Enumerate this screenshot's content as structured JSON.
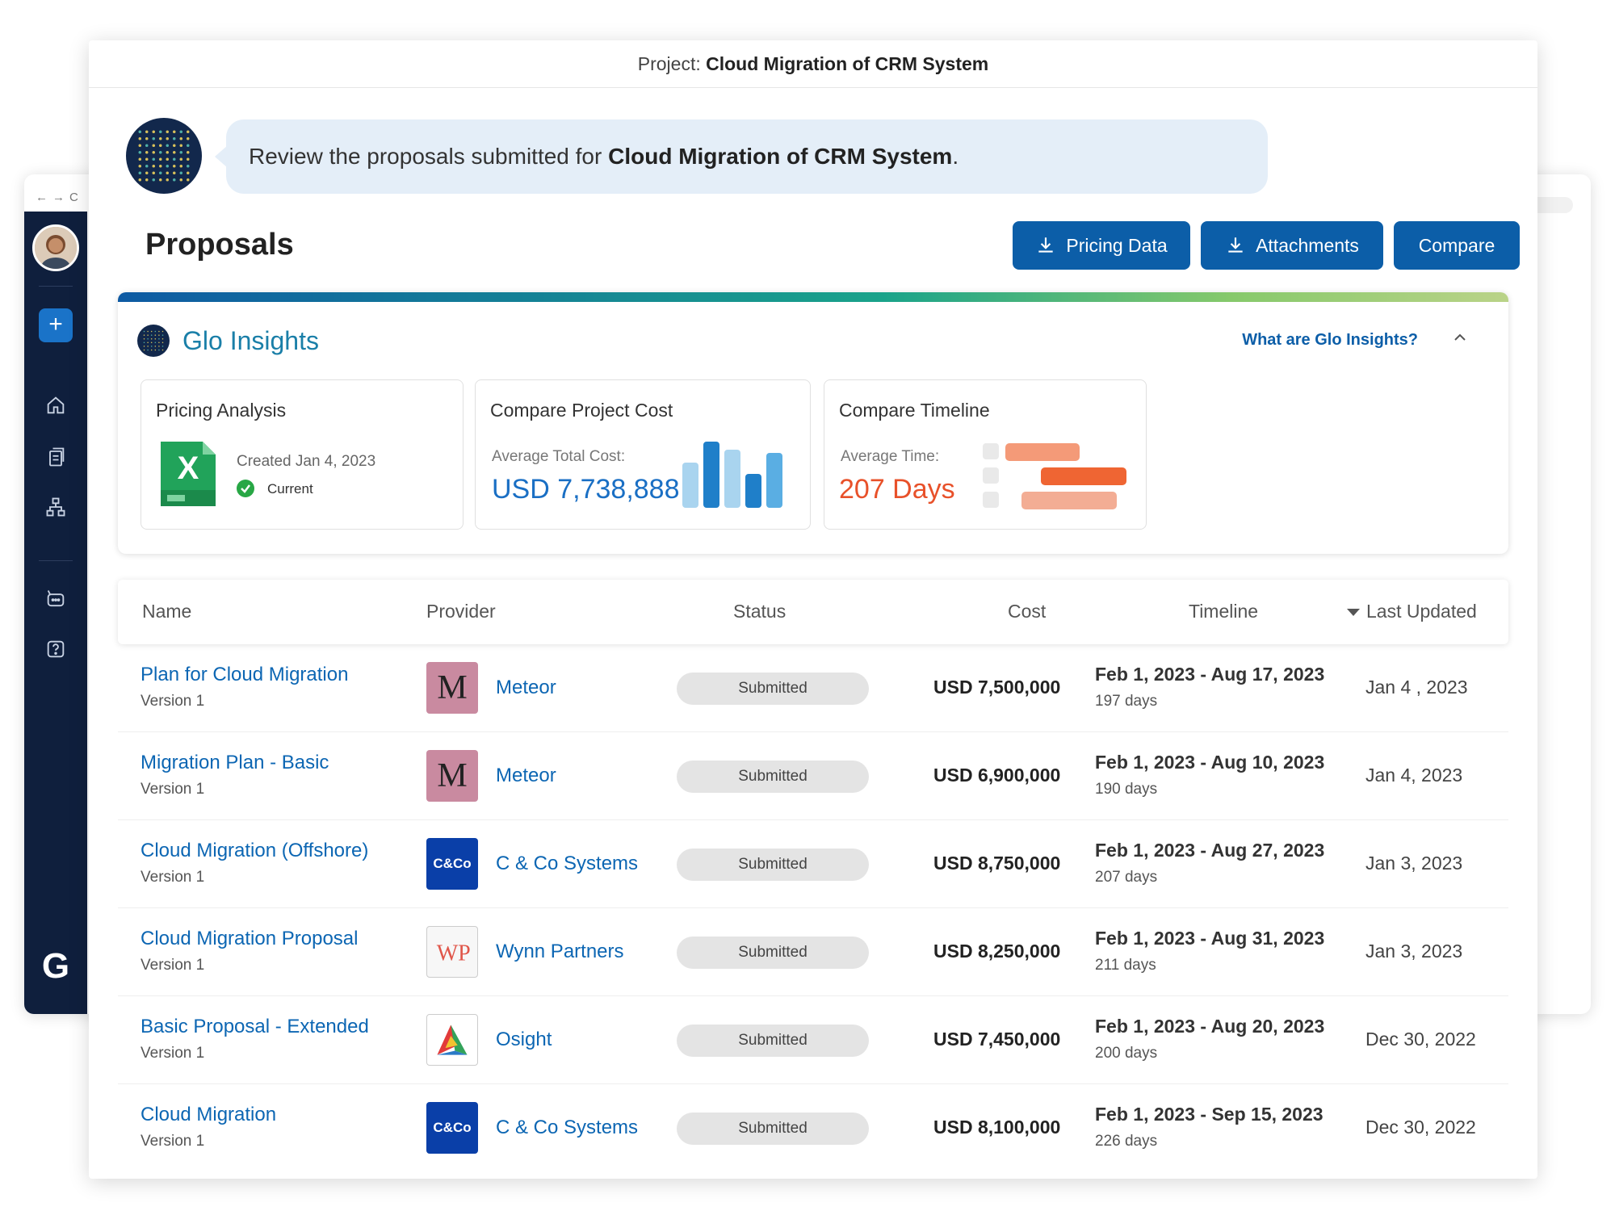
{
  "project": {
    "label": "Project:",
    "name": "Cloud Migration of CRM System"
  },
  "assistant": {
    "message_prefix": "Review the proposals submitted for",
    "message_bold": "Cloud Migration of CRM System",
    "message_suffix": "."
  },
  "page_title": "Proposals",
  "buttons": {
    "pricing": "Pricing Data",
    "attachments": "Attachments",
    "compare": "Compare"
  },
  "insights": {
    "title": "Glo Insights",
    "link": "What are Glo Insights?",
    "pricing": {
      "title": "Pricing Analysis",
      "created": "Created Jan 4, 2023",
      "status": "Current"
    },
    "cost": {
      "title": "Compare Project Cost",
      "label": "Average Total Cost:",
      "value": "USD 7,738,888"
    },
    "timeline": {
      "title": "Compare Timeline",
      "label": "Average Time:",
      "value": "207 Days"
    }
  },
  "table": {
    "headers": {
      "name": "Name",
      "provider": "Provider",
      "status": "Status",
      "cost": "Cost",
      "timeline": "Timeline",
      "updated": "Last Updated"
    },
    "rows": [
      {
        "name": "Plan for Cloud Migration",
        "version": "Version 1",
        "provider": "Meteor",
        "logo": "M",
        "status": "Submitted",
        "cost": "USD 7,500,000",
        "timeline": "Feb 1, 2023 - Aug 17, 2023",
        "days": "197 days",
        "updated": "Jan 4 , 2023"
      },
      {
        "name": "Migration Plan - Basic",
        "version": "Version 1",
        "provider": "Meteor",
        "logo": "M",
        "status": "Submitted",
        "cost": "USD 6,900,000",
        "timeline": "Feb 1, 2023 - Aug 10, 2023",
        "days": "190 days",
        "updated": "Jan 4, 2023"
      },
      {
        "name": "Cloud Migration (Offshore)",
        "version": "Version 1",
        "provider": "C & Co Systems",
        "logo": "C&Co",
        "status": "Submitted",
        "cost": "USD 8,750,000",
        "timeline": "Feb 1, 2023 - Aug 27, 2023",
        "days": "207 days",
        "updated": "Jan 3, 2023"
      },
      {
        "name": "Cloud Migration Proposal",
        "version": "Version 1",
        "provider": "Wynn Partners",
        "logo": "WP",
        "status": "Submitted",
        "cost": "USD 8,250,000",
        "timeline": "Feb 1, 2023 - Aug 31, 2023",
        "days": "211 days",
        "updated": "Jan 3, 2023"
      },
      {
        "name": "Basic Proposal - Extended",
        "version": "Version 1",
        "provider": "Osight",
        "logo": "",
        "status": "Submitted",
        "cost": "USD 7,450,000",
        "timeline": "Feb 1, 2023 - Aug 20, 2023",
        "days": "200 days",
        "updated": "Dec 30, 2022"
      },
      {
        "name": "Cloud Migration",
        "version": "Version 1",
        "provider": "C & Co Systems",
        "logo": "C&Co",
        "status": "Submitted",
        "cost": "USD 8,100,000",
        "timeline": "Feb 1, 2023 - Sep 15, 2023",
        "days": "226 days",
        "updated": "Dec 30, 2022"
      }
    ]
  },
  "colors": {
    "primary": "#0c5ea8",
    "sidebar": "#0f1f3d",
    "link": "#0c66b3",
    "orange": "#e8512a"
  },
  "sidebar": {
    "logo": "G"
  }
}
